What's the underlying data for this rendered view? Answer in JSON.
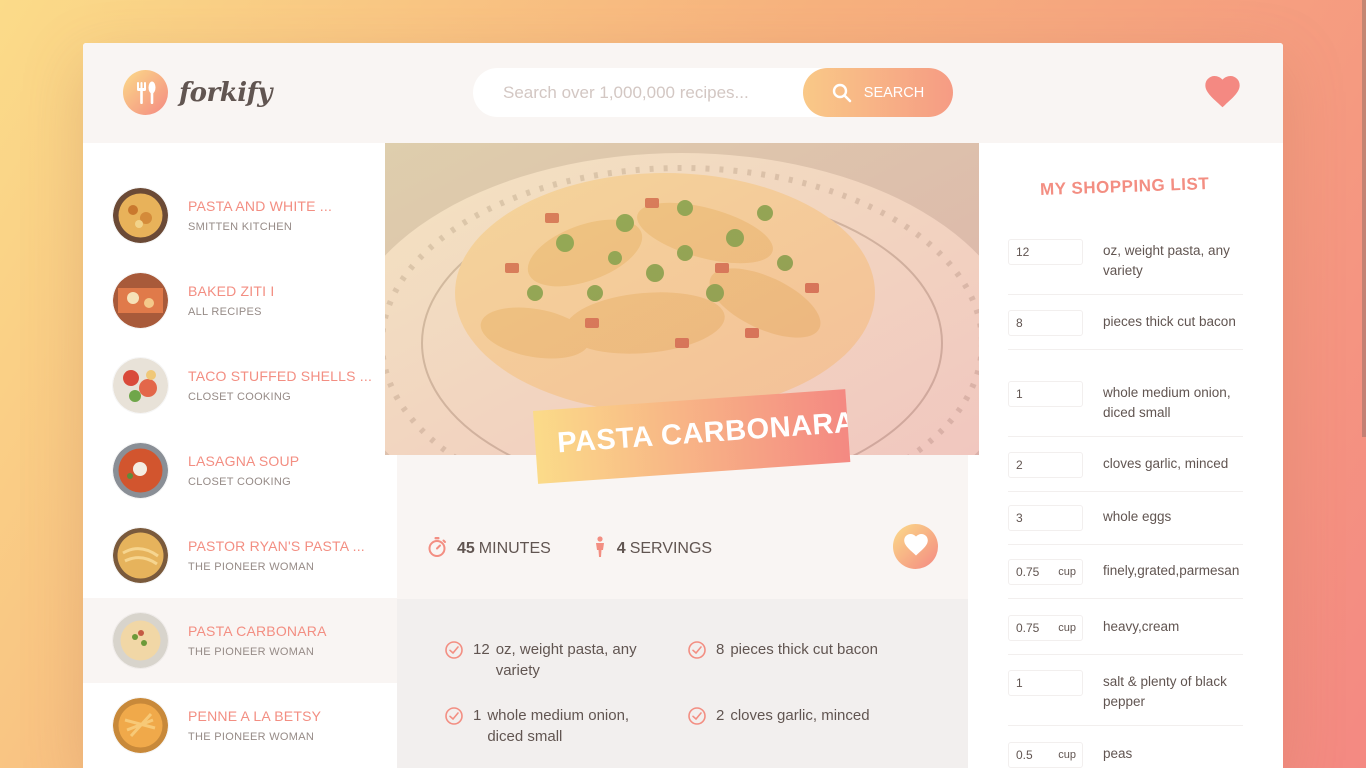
{
  "app": {
    "logo_text": "forkify"
  },
  "search": {
    "placeholder": "Search over 1,000,000 recipes...",
    "button_label": "SEARCH",
    "value": ""
  },
  "results": [
    {
      "title": "PASTA AND WHITE ...",
      "author": "SMITTEN KITCHEN",
      "active": false
    },
    {
      "title": "BAKED ZITI I",
      "author": "ALL RECIPES",
      "active": false
    },
    {
      "title": "TACO STUFFED SHELLS ...",
      "author": "CLOSET COOKING",
      "active": false
    },
    {
      "title": "LASAGNA SOUP",
      "author": "CLOSET COOKING",
      "active": false
    },
    {
      "title": "PASTOR RYAN'S PASTA ...",
      "author": "THE PIONEER WOMAN",
      "active": false
    },
    {
      "title": "PASTA CARBONARA",
      "author": "THE PIONEER WOMAN",
      "active": true
    },
    {
      "title": "PENNE A LA BETSY",
      "author": "THE PIONEER WOMAN",
      "active": false
    }
  ],
  "recipe": {
    "title": "PASTA CARBONARA",
    "time": {
      "value": "45",
      "unit": "MINUTES"
    },
    "servings": {
      "value": "4",
      "unit": "SERVINGS"
    },
    "ingredients": [
      {
        "count": "12",
        "desc": "oz, weight pasta, any variety"
      },
      {
        "count": "8",
        "desc": "pieces thick cut bacon"
      },
      {
        "count": "1",
        "desc": "whole medium onion, diced small"
      },
      {
        "count": "2",
        "desc": "cloves garlic, minced"
      }
    ]
  },
  "shopping": {
    "title": "MY SHOPPING LIST",
    "items": [
      {
        "count": "12",
        "unit": "",
        "desc": "oz, weight pasta, any variety"
      },
      {
        "count": "8",
        "unit": "",
        "desc": "pieces thick cut bacon"
      },
      {
        "count": "1",
        "unit": "",
        "desc": "whole medium onion, diced small"
      },
      {
        "count": "2",
        "unit": "",
        "desc": "cloves garlic, minced"
      },
      {
        "count": "3",
        "unit": "",
        "desc": "whole eggs"
      },
      {
        "count": "0.75",
        "unit": "cup",
        "desc": "finely,grated,parmesan"
      },
      {
        "count": "0.75",
        "unit": "cup",
        "desc": "heavy,cream"
      },
      {
        "count": "1",
        "unit": "",
        "desc": "salt & plenty of black pepper"
      },
      {
        "count": "0.5",
        "unit": "cup",
        "desc": "peas"
      }
    ]
  },
  "colors": {
    "accent": "#f38e82",
    "grad_start": "#fbdb89",
    "grad_end": "#f48982",
    "text": "#615551"
  }
}
